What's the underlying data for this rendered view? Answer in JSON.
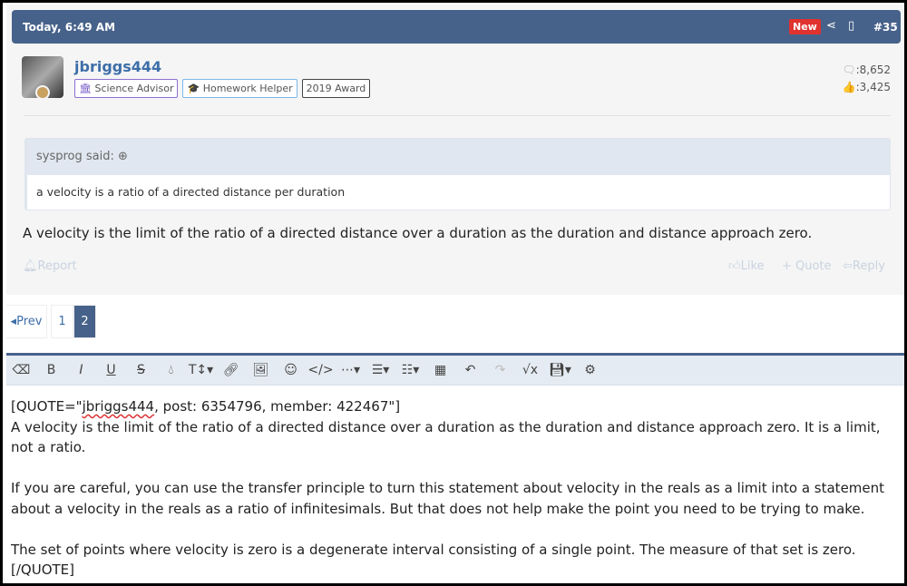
{
  "header": {
    "time": "Today, 6:49 AM",
    "new_badge": "New",
    "post_number": "#35"
  },
  "user": {
    "name": "jbriggs444",
    "tags": [
      "Science Advisor",
      "Homework Helper",
      "2019 Award"
    ],
    "messages": ":8,652",
    "reactions": ":3,425"
  },
  "quote": {
    "author": "sysprog said:",
    "text": "a velocity is a ratio of a directed distance per duration"
  },
  "post_body": "A velocity is the limit of the ratio of a directed distance over a duration as the duration and distance approach zero.",
  "actions": {
    "report": "Report",
    "like": "Like",
    "quote": "+ Quote",
    "reply": "Reply"
  },
  "pagination": {
    "prev": "Prev",
    "pages": [
      "1",
      "2"
    ],
    "current": "2"
  },
  "editor": {
    "line1_pre": "[QUOTE=\"",
    "line1_user": "jbriggs444",
    "line1_post": ", post: 6354796, member: 422467\"]",
    "p1": "A velocity is the limit of the ratio of a directed distance over a duration as the duration and distance approach zero. It is a limit, not a ratio.",
    "p2": "If you are careful, you can use the transfer principle to turn this statement about velocity in the reals as a limit into a statement about a velocity in the reals as a ratio of infinitesimals. But that does not help make the point you need to be trying to make.",
    "p3": "The set of points where velocity is zero is a degenerate interval consisting of a single point. The measure of that set is zero.",
    "end": "[/QUOTE]"
  }
}
